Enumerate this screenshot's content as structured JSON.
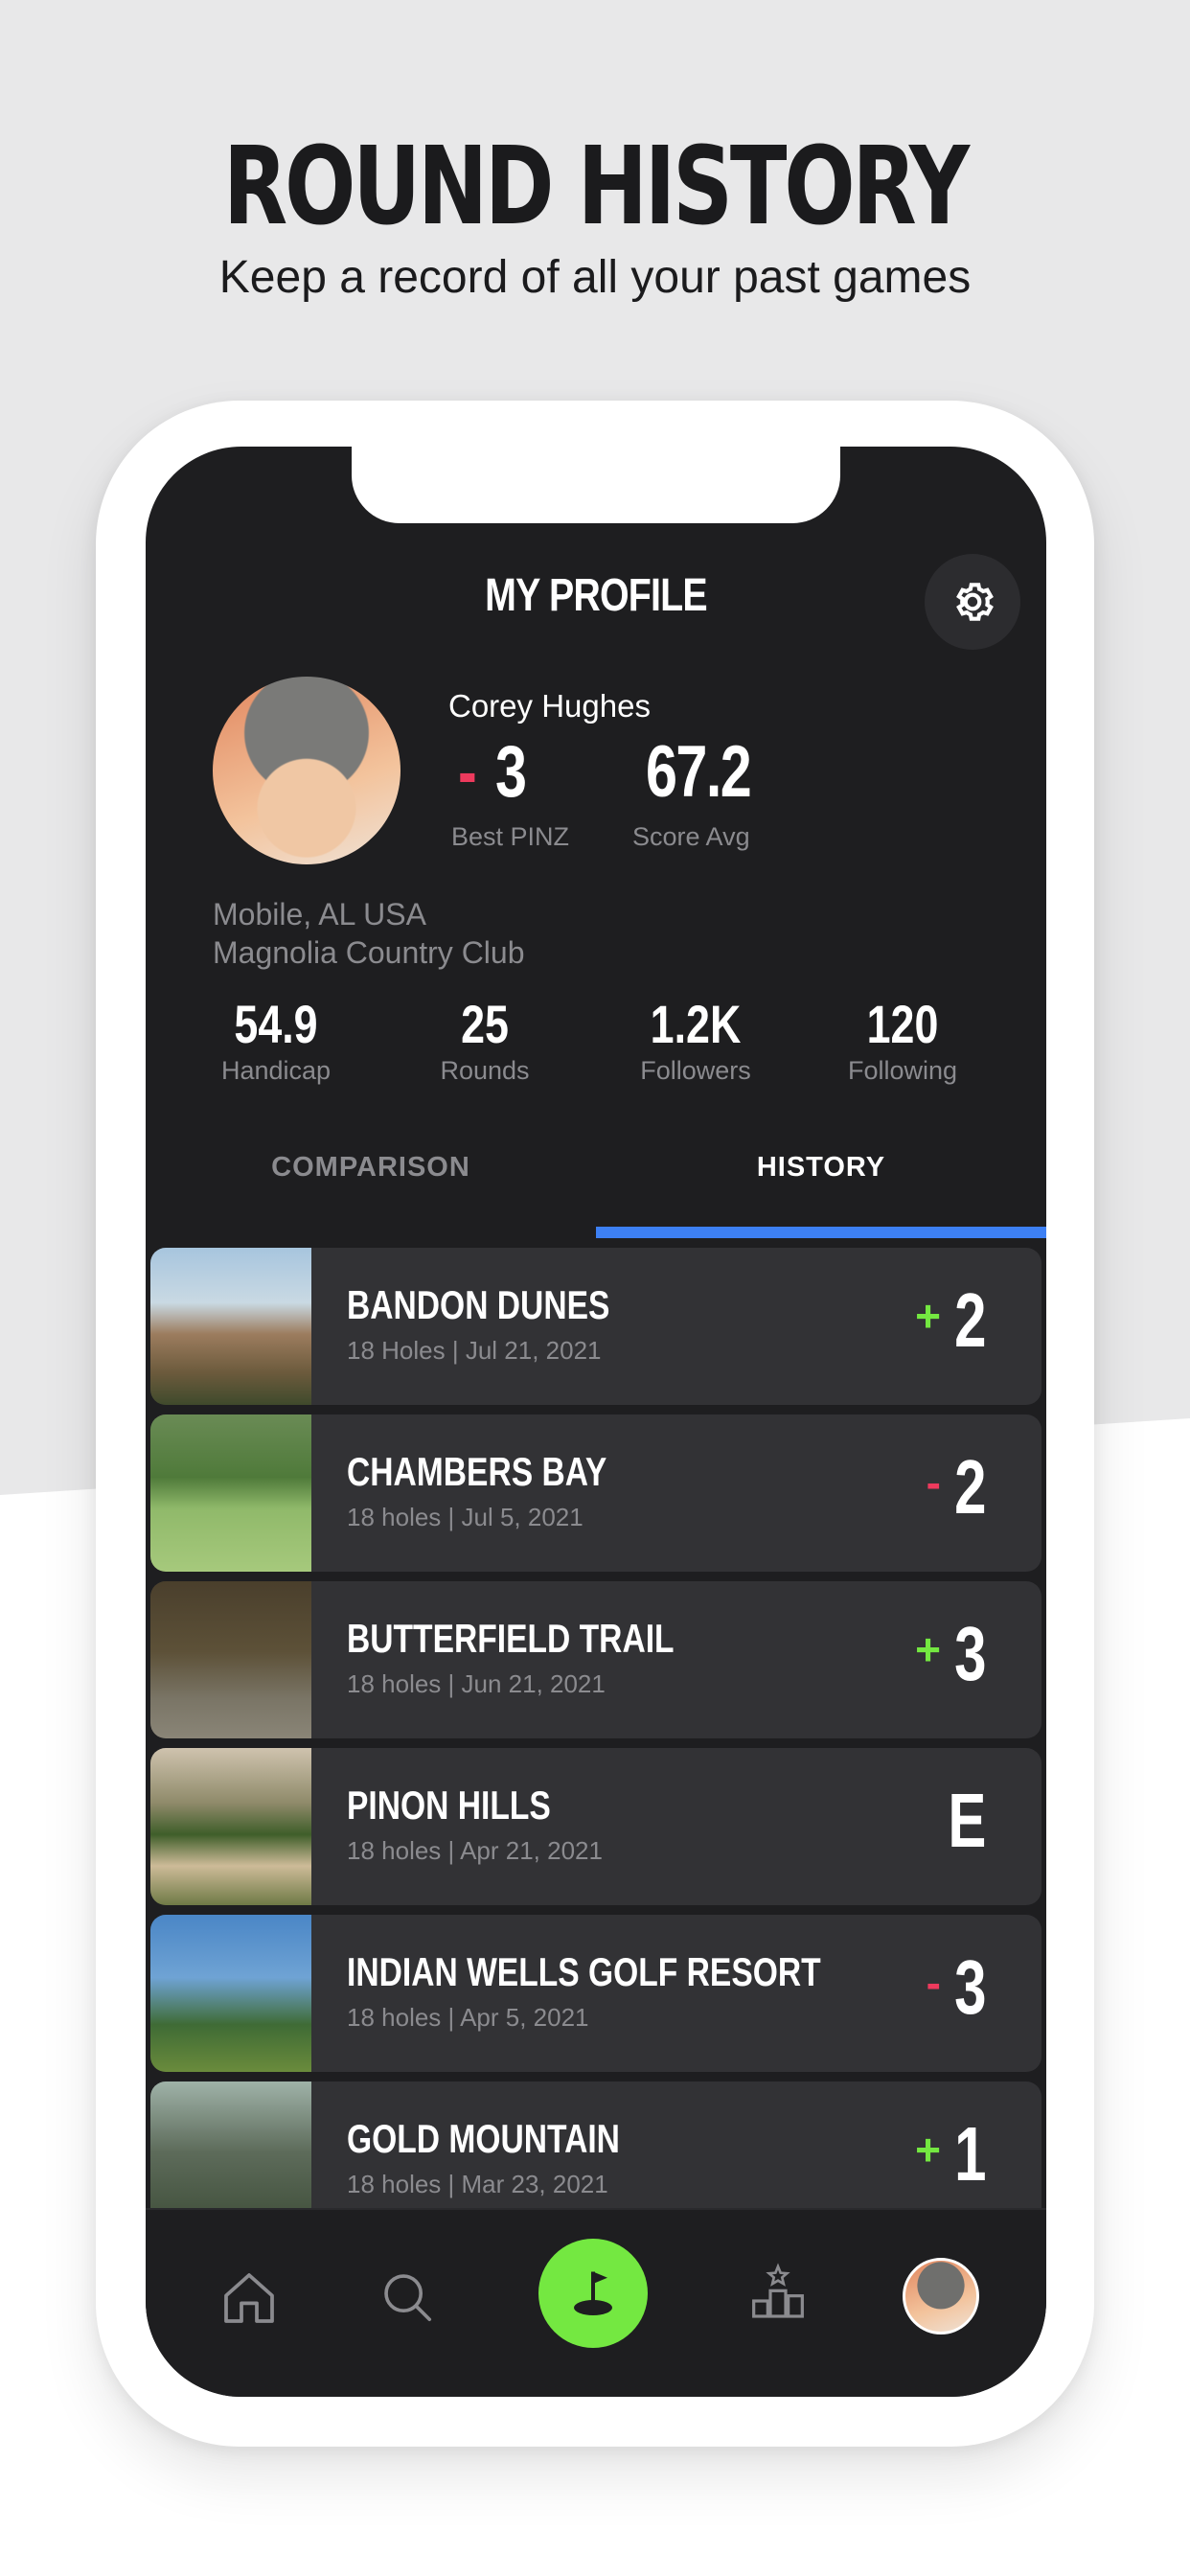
{
  "promo": {
    "headline": "ROUND HISTORY",
    "subheadline": "Keep a record of all your past games"
  },
  "header": {
    "title": "MY PROFILE",
    "settings_icon": "gear-icon"
  },
  "profile": {
    "name": "Corey Hughes",
    "best_sign": "-",
    "best_value": "3",
    "best_label": "Best PINZ",
    "avg_value": "67.2",
    "avg_label": "Score Avg",
    "location": "Mobile, AL USA",
    "club": "Magnolia Country Club",
    "stats": [
      {
        "value": "54.9",
        "label": "Handicap"
      },
      {
        "value": "25",
        "label": "Rounds"
      },
      {
        "value": "1.2K",
        "label": "Followers"
      },
      {
        "value": "120",
        "label": "Following"
      }
    ]
  },
  "tabs": {
    "comparison": "COMPARISON",
    "history": "HISTORY",
    "active": "history"
  },
  "rounds": [
    {
      "course": "BANDON DUNES",
      "detail": "18 Holes  |  Jul 21, 2021",
      "sign": "+",
      "score": "2"
    },
    {
      "course": "CHAMBERS BAY",
      "detail": "18 holes  |  Jul 5, 2021",
      "sign": "-",
      "score": "2"
    },
    {
      "course": "BUTTERFIELD TRAIL",
      "detail": "18 holes  |  Jun 21, 2021",
      "sign": "+",
      "score": "3"
    },
    {
      "course": "PINON HILLS",
      "detail": "18 holes  |  Apr 21, 2021",
      "sign": "",
      "score": "E"
    },
    {
      "course": "INDIAN WELLS GOLF RESORT",
      "detail": "18 holes  |  Apr 5, 2021",
      "sign": "-",
      "score": "3"
    },
    {
      "course": "GOLD MOUNTAIN",
      "detail": "18 holes  |  Mar 23, 2021",
      "sign": "+",
      "score": "1"
    }
  ],
  "tabbar": {
    "items": [
      "home-icon",
      "search-icon",
      "golf-flag-icon",
      "leaderboard-icon",
      "profile-avatar"
    ]
  },
  "colors": {
    "background_dark": "#1e1e20",
    "card": "#323235",
    "accent_green": "#74e841",
    "accent_red": "#ee3a5d",
    "accent_blue": "#3d80f4"
  }
}
